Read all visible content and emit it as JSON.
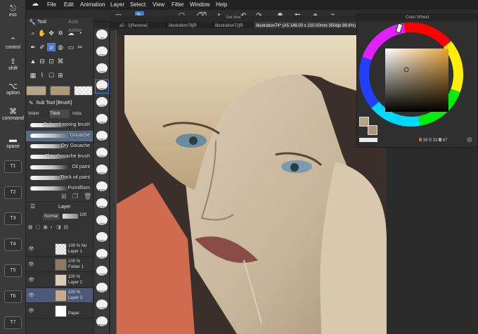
{
  "edge_keys": [
    {
      "symbol": "⎋",
      "label": "esc"
    },
    {
      "symbol": "⌃",
      "label": "control"
    },
    {
      "symbol": "⇧",
      "label": "shift"
    },
    {
      "symbol": "⌥",
      "label": "option"
    },
    {
      "symbol": "⌘",
      "label": "command"
    },
    {
      "symbol": "▬",
      "label": "space"
    }
  ],
  "tkeys": [
    "T1",
    "T2",
    "T3",
    "T4",
    "T5",
    "T6",
    "T7"
  ],
  "menu": [
    "File",
    "Edit",
    "Animation",
    "Layer",
    "Select",
    "View",
    "Filter",
    "Window",
    "Help"
  ],
  "subview_label": "Sub View",
  "tabs": [
    {
      "label": "a2 - 1[Restore]",
      "active": false
    },
    {
      "label": "illustration76[R",
      "active": false
    },
    {
      "label": "illustration72[R",
      "active": false
    },
    {
      "label": "illustration74* (A5 148.00 x 210.00mm 350dpi 89.6%)",
      "active": true
    }
  ],
  "tool_panel": {
    "title": "Tool",
    "subtitle": "Auto Action"
  },
  "colors": {
    "main": "#b5a485",
    "sub": "#a99a78",
    "accent": "#4a7bd1",
    "panel_bg": "#353535"
  },
  "sub_tool": {
    "title": "Sub Tool [Brush]",
    "tabs": [
      "Water",
      "Thick",
      "India"
    ],
    "brushes": [
      "Colored mixing brush",
      "Gouache",
      "Dry Gouache",
      "Thin Gouache brush",
      "Oil paint",
      "Thick oil paint",
      "Pointillism"
    ]
  },
  "layer_panel": {
    "title": "Layer",
    "blend": "Normal",
    "opacity": "100",
    "layers": [
      {
        "opacity": "100 % No",
        "name": "Layer 1",
        "selected": false
      },
      {
        "opacity": "100 %",
        "name": "Folder 1",
        "selected": false
      },
      {
        "opacity": "100 %",
        "name": "Layer 2",
        "selected": false
      },
      {
        "opacity": "100 %",
        "name": "Layer 3",
        "selected": true
      },
      {
        "opacity": "",
        "name": "Paper",
        "selected": false
      }
    ]
  },
  "brush_sizes": [
    "70",
    "100",
    "120",
    "150",
    "170",
    "200",
    "250",
    "300",
    "400",
    "500",
    "600",
    "700",
    "800",
    "1000",
    "1200",
    "1500",
    "1700",
    "2000"
  ],
  "color_wheel": {
    "title": "Color Wheel",
    "h": "39",
    "s": "33",
    "v": "67"
  }
}
